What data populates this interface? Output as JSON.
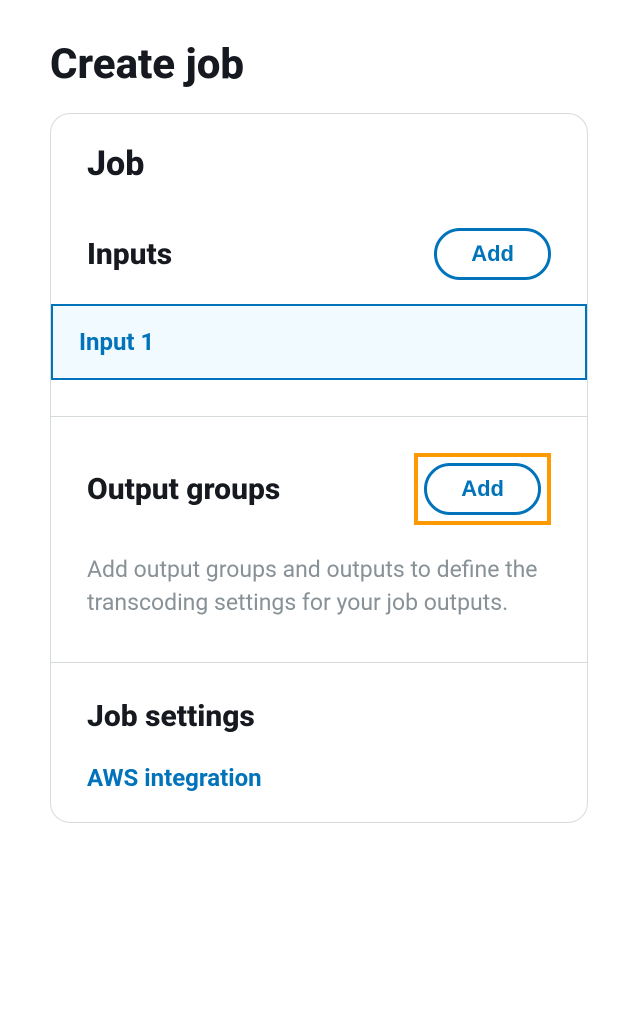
{
  "page": {
    "title": "Create job"
  },
  "panel": {
    "title": "Job"
  },
  "inputs": {
    "title": "Inputs",
    "add_label": "Add",
    "items": [
      {
        "label": "Input 1"
      }
    ]
  },
  "output_groups": {
    "title": "Output groups",
    "add_label": "Add",
    "helper_text": "Add output groups and outputs to define the transcoding settings for your job outputs."
  },
  "job_settings": {
    "title": "Job settings",
    "links": [
      {
        "label": "AWS integration"
      }
    ]
  }
}
